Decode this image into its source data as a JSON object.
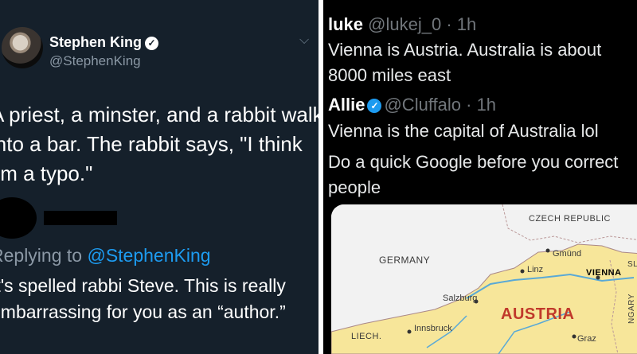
{
  "left_tweet": {
    "display_name": "Stephen King",
    "handle": "@StephenKing",
    "text": "A priest, a minster, and a rabbit walk into a bar. The rabbit says, \"I think I'm a typo.\""
  },
  "left_reply": {
    "replying_prefix": "Replying to",
    "replying_to": "@StephenKing",
    "text": "It's spelled rabbi Steve. This is really embarrassing for you as an “author.”"
  },
  "right_reply1": {
    "name": "luke",
    "handle": "@lukej_0",
    "time": "· 1h",
    "text_line1": "Vienna is Austria. Australia is about",
    "text_line2": "8000 miles east"
  },
  "right_reply2": {
    "name": "Allie",
    "handle": "@Cluffalo",
    "time": "· 1h",
    "text1": "Vienna is the capital of Australia lol",
    "text2_line1": "Do a quick Google before you correct",
    "text2_line2": "people"
  },
  "map": {
    "labels": {
      "czech": "CZECH REPUBLIC",
      "germany": "GERMANY",
      "gmund": "Gmünd",
      "linz": "Linz",
      "vienna": "VIENNA",
      "slo": "SLO",
      "salzburg": "Salzburg",
      "austria": "AUSTRIA",
      "innsbruck": "Innsbruck",
      "graz": "Graz",
      "liech": "LIECH.",
      "hungary": "NGARY"
    },
    "colors": {
      "austria_fill": "#f7e69a",
      "neighbor_fill": "#f2f2f2",
      "river": "#5aa9d6",
      "austria_label": "#c0392b"
    }
  }
}
